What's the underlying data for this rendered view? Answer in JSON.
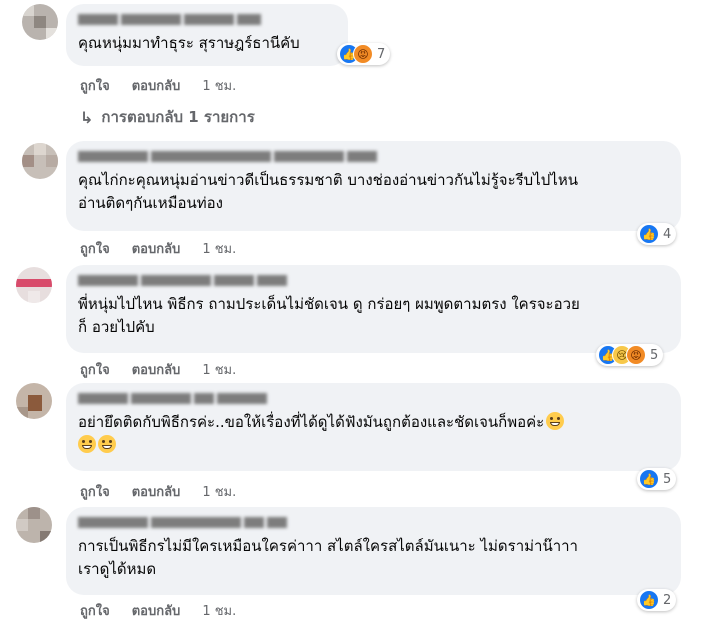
{
  "comments": [
    {
      "text": "คุณหนุ่มมาทำธุระ สุราษฎร์ธานีคับ",
      "actions": {
        "like": "ถูกใจ",
        "reply": "ตอบกลับ",
        "time": "1 ชม."
      },
      "reactions": {
        "icons": [
          "like-icon",
          "angry-icon"
        ],
        "count": "7"
      }
    },
    {
      "text": "คุณไก่กะคุณหนุ่มอ่านข่าวดีเป็นธรรมชาติ บางช่องอ่านข่าวกันไม่รู้จะรีบไปไหน\nอ่านติดๆกันเหมือนท่อง",
      "actions": {
        "like": "ถูกใจ",
        "reply": "ตอบกลับ",
        "time": "1 ชม."
      },
      "reactions": {
        "icons": [
          "like-icon"
        ],
        "count": "4"
      }
    },
    {
      "text": "พี่หนุ่มไปไหน พิธีกร ถามประเด็นไม่ชัดเจน ดู กร่อยๆ ผมพูดตามตรง ใครจะอวย\nก็ อวยไปคับ",
      "actions": {
        "like": "ถูกใจ",
        "reply": "ตอบกลับ",
        "time": "1 ชม."
      },
      "reactions": {
        "icons": [
          "like-icon",
          "sad-icon",
          "angry-icon"
        ],
        "count": "5"
      }
    },
    {
      "text": "อย่ายึดติดกับพิธีกรค่ะ..ขอให้เรื่องที่ได้ดูได้ฟังมันถูกต้องและชัดเจนก็พอค่ะ",
      "actions": {
        "like": "ถูกใจ",
        "reply": "ตอบกลับ",
        "time": "1 ชม."
      },
      "reactions": {
        "icons": [
          "like-icon"
        ],
        "count": "5"
      }
    },
    {
      "text": "การเป็นพิธีกรไม่มีใครเหมือนใครค่าาา สไตล์ใครสไตล์มันเนาะ ไม่ดราม่าน๊าาา\nเราดูได้หมด",
      "actions": {
        "like": "ถูกใจ",
        "reply": "ตอบกลับ",
        "time": "1 ชม."
      },
      "reactions": {
        "icons": [
          "like-icon"
        ],
        "count": "2"
      }
    }
  ],
  "replies_link": "การตอบกลับ 1 รายการ",
  "colors": {
    "bubble": "#f0f2f5",
    "meta": "#65676b",
    "like": "#1877f2"
  }
}
